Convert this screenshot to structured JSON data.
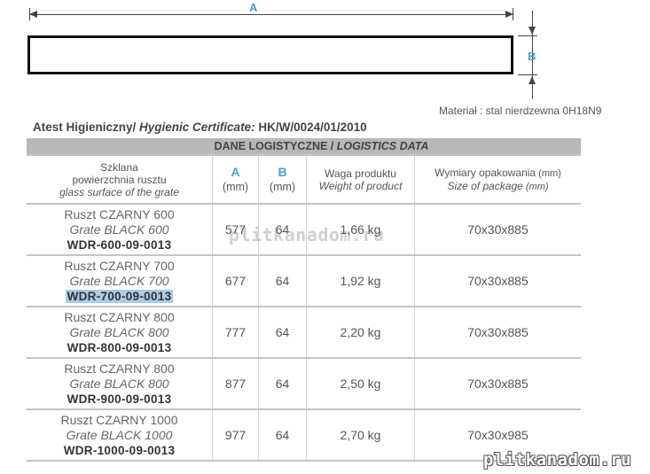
{
  "drawing": {
    "label_a": "A",
    "label_b": "B",
    "material": "Materiał : stal nierdzewna 0H18N9"
  },
  "certificate": {
    "label_pl": "Atest Higieniczny/ ",
    "label_en": "Hygienic Certificate:",
    "number": " HK/W/0024/01/2010"
  },
  "table": {
    "title_pl": "DANE LOGISTYCZNE  / ",
    "title_en": "LOGISTICS DATA",
    "headers": {
      "col1_pl_line1": "Szklana",
      "col1_pl_line2": "powierzchnia rusztu",
      "col1_en": "glass surface of the grate",
      "col2_letter": "A",
      "col2_unit": "(mm)",
      "col3_letter": "B",
      "col3_unit": "(mm)",
      "col4_pl": "Waga produktu",
      "col4_en": "Weight of product",
      "col5_pl": "Wymiary opakowania",
      "col5_pl_unit": " (mm)",
      "col5_en": "Size of package",
      "col5_en_unit": " (mm)"
    },
    "rows": [
      {
        "name_pl": "Ruszt CZARNY 600",
        "name_en": "Grate BLACK 600",
        "code": "WDR-600-09-0013",
        "a": "577",
        "b": "64",
        "weight": "1,66 kg",
        "package": "70x30x885"
      },
      {
        "name_pl": "Ruszt CZARNY 700",
        "name_en": "Grate BLACK 700",
        "code": "WDR-700-09-0013",
        "a": "677",
        "b": "64",
        "weight": "1,92 kg",
        "package": "70x30x885"
      },
      {
        "name_pl": "Ruszt CZARNY 800",
        "name_en": "Grate BLACK 800",
        "code": "WDR-800-09-0013",
        "a": "777",
        "b": "64",
        "weight": "2,20 kg",
        "package": "70x30x885"
      },
      {
        "name_pl": "Ruszt CZARNY 800",
        "name_en": "Grate BLACK 800",
        "code": "WDR-900-09-0013",
        "a": "877",
        "b": "64",
        "weight": "2,50 kg",
        "package": "70x30x885"
      },
      {
        "name_pl": "Ruszt CZARNY 1000",
        "name_en": "Grate BLACK 1000",
        "code": "WDR-1000-09-0013",
        "a": "977",
        "b": "64",
        "weight": "2,70 kg",
        "package": "70x30x985"
      }
    ]
  },
  "watermarks": {
    "center": "plitkanadom.ru",
    "corner": "plitkanadom.ru"
  },
  "colors": {
    "accent": "#3ea7c4",
    "title_bar": "#b7b8ba",
    "selection": "#a9cbe6"
  }
}
